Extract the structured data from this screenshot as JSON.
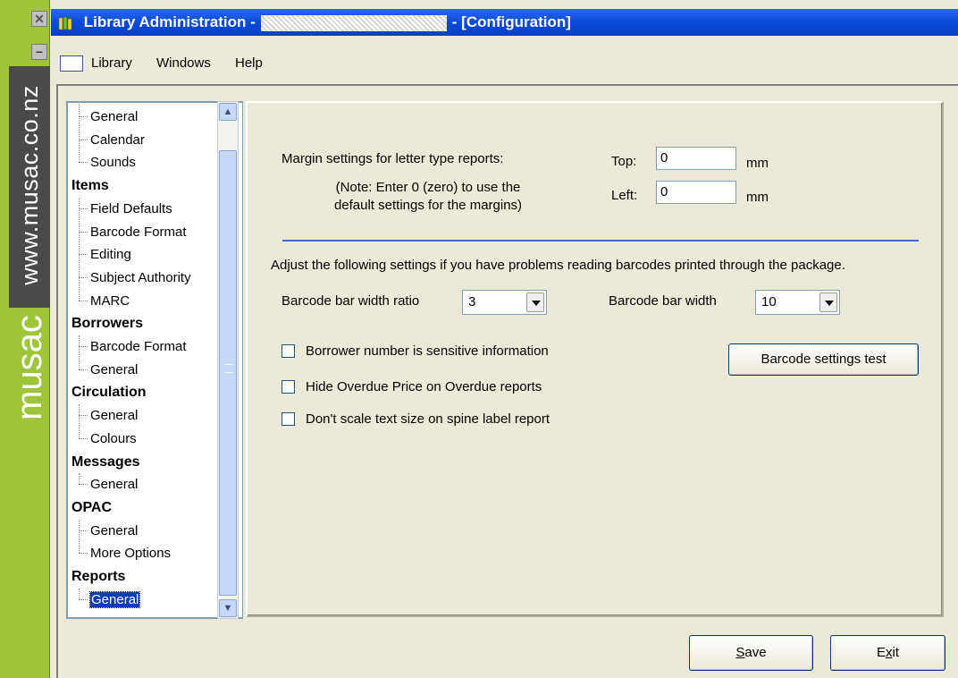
{
  "sidebar": {
    "close_glyph": "✕",
    "minimize_glyph": "–",
    "url_text": "www.musac.co.nz",
    "logo_text": "musac",
    "color": "#9fc43a"
  },
  "window": {
    "title_prefix": "Library Administration -",
    "title_suffix": "- [Configuration]",
    "title_color": "#0a4ad8",
    "app_icon": "books-icon"
  },
  "menu": {
    "items": [
      "Library",
      "Windows",
      "Help"
    ]
  },
  "tree": {
    "items": [
      {
        "label": "General",
        "level": "child"
      },
      {
        "label": "Calendar",
        "level": "child"
      },
      {
        "label": "Sounds",
        "level": "child"
      },
      {
        "label": "Items",
        "level": "category"
      },
      {
        "label": "Field Defaults",
        "level": "child"
      },
      {
        "label": "Barcode Format",
        "level": "child"
      },
      {
        "label": "Editing",
        "level": "child"
      },
      {
        "label": "Subject Authority",
        "level": "child"
      },
      {
        "label": "MARC",
        "level": "child"
      },
      {
        "label": "Borrowers",
        "level": "category"
      },
      {
        "label": "Barcode Format",
        "level": "child"
      },
      {
        "label": "General",
        "level": "child"
      },
      {
        "label": "Circulation",
        "level": "category"
      },
      {
        "label": "General",
        "level": "child"
      },
      {
        "label": "Colours",
        "level": "child"
      },
      {
        "label": "Messages",
        "level": "category"
      },
      {
        "label": "General",
        "level": "child"
      },
      {
        "label": "OPAC",
        "level": "category"
      },
      {
        "label": "General",
        "level": "child"
      },
      {
        "label": "More Options",
        "level": "child"
      },
      {
        "label": "Reports",
        "level": "category"
      },
      {
        "label": "General",
        "level": "child",
        "selected": true
      }
    ]
  },
  "panel": {
    "margin_label": "Margin settings for letter type reports:",
    "margin_note_line1": "(Note: Enter 0 (zero) to use the",
    "margin_note_line2": "default settings for the margins)",
    "top_label": "Top:",
    "top_value": "0",
    "left_label": "Left:",
    "left_value": "0",
    "unit": "mm",
    "barcode_help": "Adjust the following settings if you have problems reading barcodes printed through the package.",
    "ratio_label": "Barcode bar width ratio",
    "ratio_value": "3",
    "width_label": "Barcode bar width",
    "width_value": "10",
    "checkboxes": [
      {
        "label": "Borrower number is sensitive information",
        "checked": false
      },
      {
        "label": "Hide Overdue Price on Overdue reports",
        "checked": false
      },
      {
        "label": "Don't scale text size on spine label report",
        "checked": false
      }
    ],
    "test_button": "Barcode settings test"
  },
  "buttons": {
    "save": {
      "pre": "",
      "mnemonic": "S",
      "post": "ave"
    },
    "exit": {
      "pre": "E",
      "mnemonic": "x",
      "post": "it"
    }
  }
}
